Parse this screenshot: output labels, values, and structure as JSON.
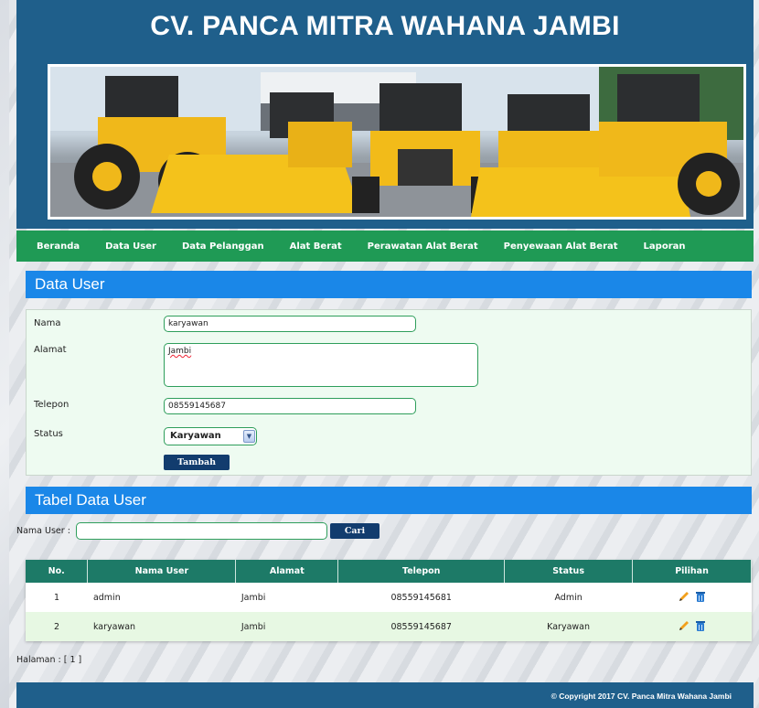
{
  "site": {
    "title": "CV. PANCA MITRA WAHANA JAMBI"
  },
  "nav": {
    "items": [
      {
        "label": "Beranda"
      },
      {
        "label": "Data User"
      },
      {
        "label": "Data Pelanggan"
      },
      {
        "label": "Alat Berat"
      },
      {
        "label": "Perawatan Alat Berat"
      },
      {
        "label": "Penyewaan Alat Berat"
      },
      {
        "label": "Laporan"
      }
    ]
  },
  "form": {
    "section_title": "Data User",
    "nama_label": "Nama",
    "nama_value": "karyawan",
    "alamat_label": "Alamat",
    "alamat_value": "Jambi",
    "telepon_label": "Telepon",
    "telepon_value": "08559145687",
    "status_label": "Status",
    "status_value": "Karyawan",
    "submit_label": "Tambah"
  },
  "table_section": {
    "title": "Tabel Data User",
    "search_label": "Nama User :",
    "search_value": "",
    "search_button": "Cari",
    "columns": [
      "No.",
      "Nama User",
      "Alamat",
      "Telepon",
      "Status",
      "Pilihan"
    ],
    "rows": [
      {
        "no": "1",
        "nama": "admin",
        "alamat": "Jambi",
        "telepon": "08559145681",
        "status": "Admin"
      },
      {
        "no": "2",
        "nama": "karyawan",
        "alamat": "Jambi",
        "telepon": "08559145687",
        "status": "Karyawan"
      }
    ],
    "pagination": "Halaman : [ 1 ]"
  },
  "icons": {
    "edit": "pencil-icon",
    "delete": "trash-icon"
  },
  "colors": {
    "header": "#1f5f8b",
    "nav": "#1f9a55",
    "section": "#1a87e8",
    "table_header": "#1d7a67",
    "button": "#123c6e"
  },
  "footer": {
    "copyright": "© Copyright 2017 CV. Panca Mitra Wahana Jambi"
  }
}
